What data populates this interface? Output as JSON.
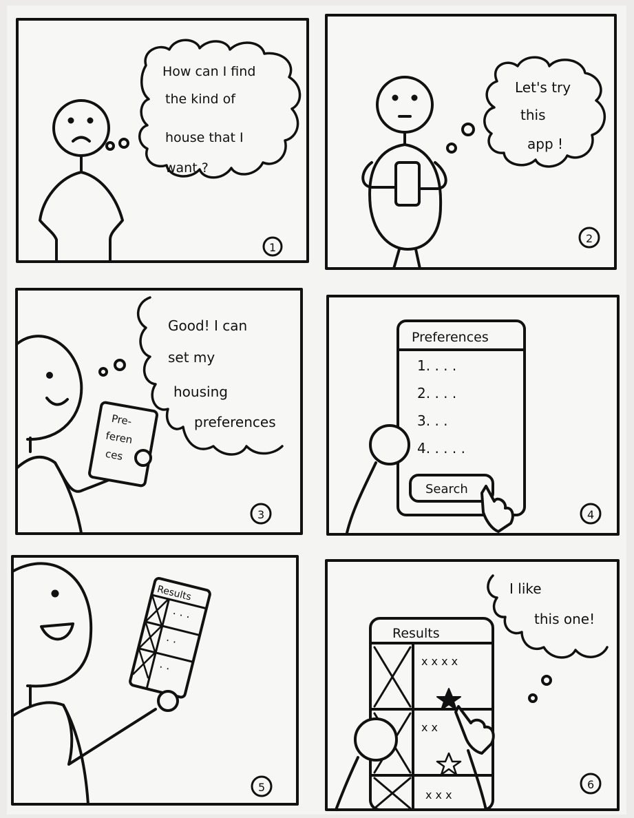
{
  "panels": [
    {
      "number": "1",
      "speech": [
        "How can I find",
        "the kind of",
        "house that I",
        "want ?"
      ]
    },
    {
      "number": "2",
      "speech": [
        "Let's try",
        "this",
        "app !"
      ]
    },
    {
      "number": "3",
      "speech": [
        "Good! I can",
        "set my",
        "housing",
        "preferences"
      ],
      "phone_label": [
        "Pre-",
        "feren",
        "ces"
      ]
    },
    {
      "number": "4",
      "screen_title": "Preferences",
      "list": [
        "1. . . .",
        "2. . . .",
        "3. . .",
        "4. . . . ."
      ],
      "button_label": "Search"
    },
    {
      "number": "5",
      "screen_title": "Results",
      "row_dots": [
        "· · ·",
        "· ·",
        "· ·"
      ]
    },
    {
      "number": "6",
      "screen_title": "Results",
      "speech": [
        "I like",
        "this one!"
      ],
      "row_marks": [
        "x x x x",
        "x x",
        "x x x"
      ]
    }
  ]
}
